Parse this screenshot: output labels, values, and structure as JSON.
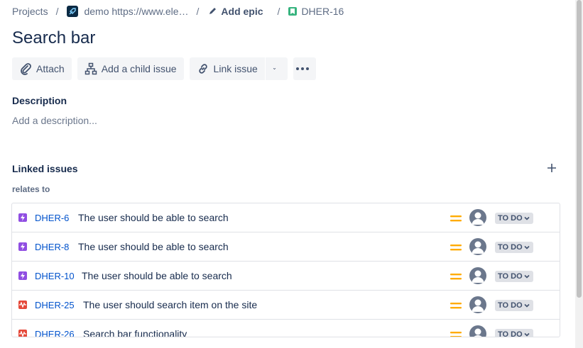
{
  "breadcrumbs": {
    "projects": "Projects",
    "project": "demo https://www.ele…",
    "add_epic": "Add epic",
    "issue_key": "DHER-16"
  },
  "title": "Search bar",
  "toolbar": {
    "attach": "Attach",
    "add_child": "Add a child issue",
    "link_issue": "Link issue"
  },
  "description": {
    "label": "Description",
    "placeholder": "Add a description..."
  },
  "linked_issues": {
    "label": "Linked issues",
    "relation": "relates to",
    "items": [
      {
        "type": "epic",
        "key": "DHER-6",
        "summary": "The user should be able to search",
        "status": "TO DO",
        "priority": "medium"
      },
      {
        "type": "epic",
        "key": "DHER-8",
        "summary": "The user should be able to search",
        "status": "TO DO",
        "priority": "medium"
      },
      {
        "type": "epic",
        "key": "DHER-10",
        "summary": "The user should be able to search",
        "status": "TO DO",
        "priority": "medium"
      },
      {
        "type": "bug",
        "key": "DHER-25",
        "summary": "The user should search item on the site",
        "status": "TO DO",
        "priority": "medium"
      },
      {
        "type": "bug",
        "key": "DHER-26",
        "summary": "Search bar functionality",
        "status": "TO DO",
        "priority": "medium"
      }
    ]
  },
  "colors": {
    "link": "#0052CC",
    "epic": "#904EE2",
    "bug": "#E5493A",
    "story": "#36B37E",
    "priority_medium": "#FFAB00"
  }
}
